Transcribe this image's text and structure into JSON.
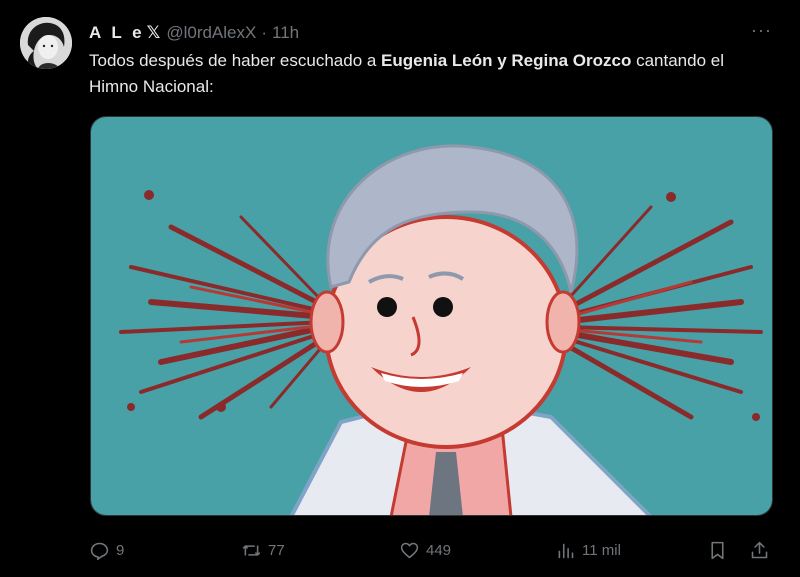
{
  "author": {
    "display_name": "A L e",
    "verified_mark": "𝕏",
    "handle": "@l0rdAlexX",
    "separator": "·",
    "time": "11h"
  },
  "more_label": "···",
  "tweet": {
    "text_part1": "Todos después de haber escuchado a ",
    "text_bold": "Eugenia León y Regina Orozco",
    "text_part2": " cantando el Himno Nacional:"
  },
  "actions": {
    "replies": "9",
    "reposts": "77",
    "likes": "449",
    "views": "11 mil"
  },
  "colors": {
    "background": "#000000",
    "text": "#e7e9ea",
    "muted": "#71767b",
    "media_bg": "#47a1a6"
  }
}
